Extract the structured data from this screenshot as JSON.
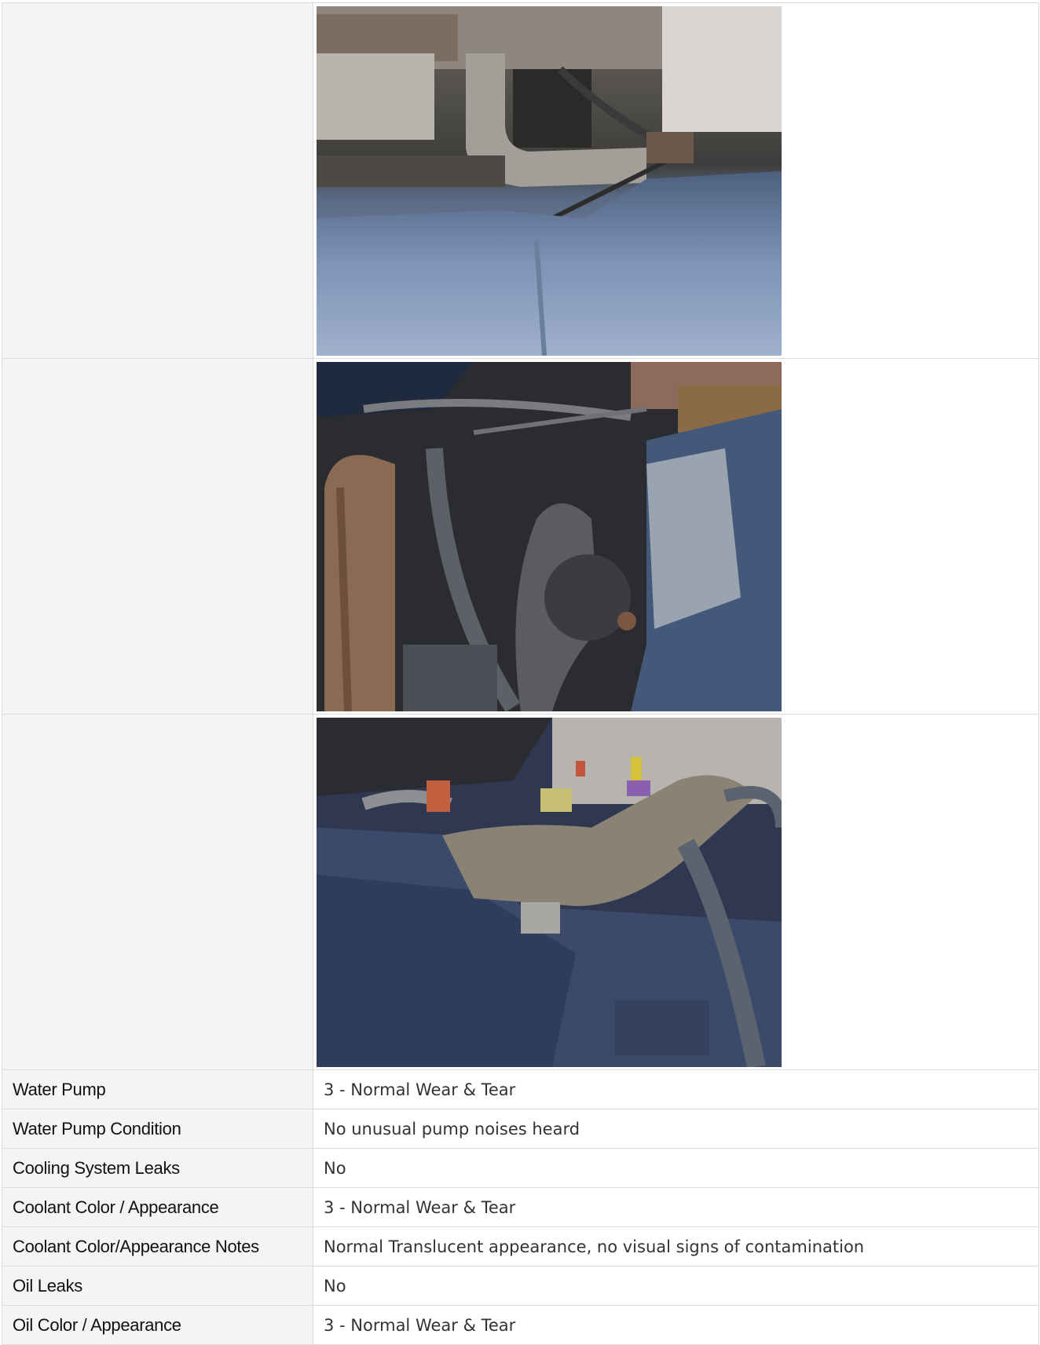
{
  "photos": [
    {
      "icon": "engine-photo-icon",
      "subject": "radiator hose and fan shroud"
    },
    {
      "icon": "engine-photo-icon",
      "subject": "engine belts and hoses"
    },
    {
      "icon": "engine-photo-icon",
      "subject": "air intake tube and connectors"
    }
  ],
  "rows": [
    {
      "label": "Water Pump",
      "value": "3 - Normal Wear & Tear"
    },
    {
      "label": "Water Pump Condition",
      "value": "No unusual pump noises heard"
    },
    {
      "label": "Cooling System Leaks",
      "value": "No"
    },
    {
      "label": "Coolant Color / Appearance",
      "value": "3 - Normal Wear & Tear"
    },
    {
      "label": "Coolant Color/Appearance Notes",
      "value": "Normal Translucent appearance, no visual signs of contamination"
    },
    {
      "label": "Oil Leaks",
      "value": "No"
    },
    {
      "label": "Oil Color / Appearance",
      "value": "3 - Normal Wear & Tear"
    }
  ],
  "colors": {
    "border": "#dcdcdc",
    "label_background": "#f4f4f4",
    "label_text": "#111111",
    "value_text": "#333333"
  }
}
